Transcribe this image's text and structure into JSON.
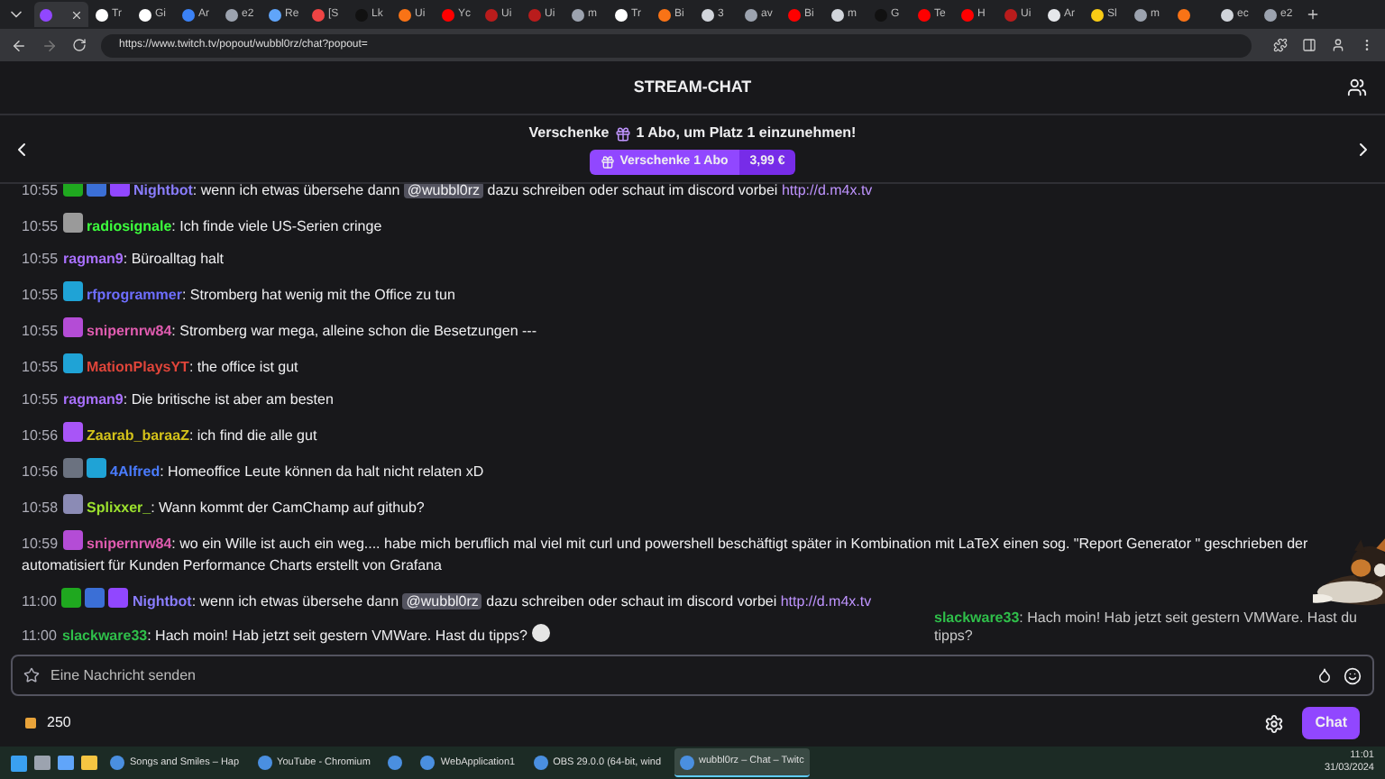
{
  "browser_tabs": [
    {
      "color": "#9147ff",
      "selected": true
    },
    {
      "label": "Tr",
      "color": "#ffffff",
      "selected": false
    },
    {
      "label": "Gi",
      "color": "#ffffff",
      "selected": false
    },
    {
      "label": "Ar",
      "color": "#3b82f6",
      "selected": false
    },
    {
      "label": "e2",
      "color": "#9ca3af",
      "selected": false
    },
    {
      "label": "Re",
      "color": "#60a5fa",
      "selected": false
    },
    {
      "label": "[S",
      "color": "#ef4444",
      "selected": false
    },
    {
      "label": "Lk",
      "color": "#111111",
      "selected": false
    },
    {
      "label": "Ui",
      "color": "#f97316",
      "selected": false
    },
    {
      "label": "Yc",
      "color": "#ff0000",
      "selected": false
    },
    {
      "label": "Ui",
      "color": "#b91c1c",
      "selected": false
    },
    {
      "label": "Ui",
      "color": "#b91c1c",
      "selected": false
    },
    {
      "label": "m",
      "color": "#9ca3af",
      "selected": false
    },
    {
      "label": "Tr",
      "color": "#ffffff",
      "selected": false
    },
    {
      "label": "Bi",
      "color": "#f97316",
      "selected": false
    },
    {
      "label": "3",
      "color": "#d1d5db",
      "selected": false
    },
    {
      "label": "av",
      "color": "#9ca3af",
      "selected": false
    },
    {
      "label": "Bi",
      "color": "#ff0000",
      "selected": false
    },
    {
      "label": "m",
      "color": "#d1d5db",
      "selected": false
    },
    {
      "label": "G",
      "color": "#111111",
      "selected": false
    },
    {
      "label": "Te",
      "color": "#ff0000",
      "selected": false
    },
    {
      "label": "H",
      "color": "#ff0000",
      "selected": false
    },
    {
      "label": "Ui",
      "color": "#b91c1c",
      "selected": false
    },
    {
      "label": "Ar",
      "color": "#e5e7eb",
      "selected": false
    },
    {
      "label": "Sl",
      "color": "#facc15",
      "selected": false
    },
    {
      "label": "m",
      "color": "#9ca3af",
      "selected": false
    },
    {
      "color": "#f97316",
      "selected": false
    },
    {
      "label": "ec",
      "color": "#d1d5db",
      "selected": false
    },
    {
      "label": "e2",
      "color": "#9ca3af",
      "selected": false
    }
  ],
  "address": "https://www.twitch.tv/popout/wubbl0rz/chat?popout=",
  "header": {
    "title": "STREAM-CHAT"
  },
  "banner": {
    "text": "Verschenke",
    "count": "1",
    "rest": "Abo, um Platz 1 einzunehmen!",
    "button": "Verschenke 1 Abo",
    "price": "3,99 €"
  },
  "messages": [
    {
      "time": "10:55",
      "badges": [
        {
          "color": "#1fa81f"
        },
        {
          "color": "#3b6fd6"
        },
        {
          "color": "#9147ff"
        }
      ],
      "user": "Nightbot",
      "color": "#8a7dff",
      "parts": [
        {
          "kind": "text",
          "text": ": wenn ich etwas übersehe dann "
        },
        {
          "kind": "mention",
          "text": "@wubbl0rz"
        },
        {
          "kind": "text",
          "text": " dazu schreiben oder schaut im discord vorbei "
        },
        {
          "kind": "link",
          "text": "http://d.m4x.tv"
        }
      ]
    },
    {
      "time": "10:55",
      "badges": [
        {
          "color": "#9a9a9a"
        }
      ],
      "user": "radiosignale",
      "color": "#3dff3d",
      "parts": [
        {
          "kind": "text",
          "text": ": Ich finde viele US-Serien cringe"
        }
      ]
    },
    {
      "time": "10:55",
      "user": "ragman9",
      "color": "#a970ff",
      "parts": [
        {
          "kind": "text",
          "text": ": Büroalltag halt"
        }
      ]
    },
    {
      "time": "10:55",
      "badges": [
        {
          "color": "#1fa3d6"
        }
      ],
      "user": "rfprogrammer",
      "color": "#6e6eff",
      "parts": [
        {
          "kind": "text",
          "text": ": Stromberg hat wenig mit the Office zu tun"
        }
      ]
    },
    {
      "time": "10:55",
      "badges": [
        {
          "color": "#b44cd6"
        }
      ],
      "user": "snipernrw84",
      "color": "#e05cb0",
      "parts": [
        {
          "kind": "text",
          "text": ": Stromberg war mega, alleine schon die Besetzungen ---"
        }
      ]
    },
    {
      "time": "10:55",
      "badges": [
        {
          "color": "#1fa3d6"
        }
      ],
      "user": "MationPlaysYT",
      "color": "#e0453a",
      "parts": [
        {
          "kind": "text",
          "text": ": the office ist gut"
        }
      ]
    },
    {
      "time": "10:55",
      "user": "ragman9",
      "color": "#a970ff",
      "parts": [
        {
          "kind": "text",
          "text": ": Die britische ist aber am besten"
        }
      ]
    },
    {
      "time": "10:56",
      "badges": [
        {
          "color": "#a855f7"
        }
      ],
      "user": "Zaarab_baraaZ",
      "color": "#d4c21a",
      "parts": [
        {
          "kind": "text",
          "text": ": ich find die alle gut"
        }
      ]
    },
    {
      "time": "10:56",
      "badges": [
        {
          "color": "#6b7280"
        },
        {
          "color": "#1fa3d6"
        }
      ],
      "user": "4Alfred",
      "color": "#4a7cff",
      "parts": [
        {
          "kind": "text",
          "text": ": Homeoffice Leute können da halt nicht relaten xD"
        }
      ]
    },
    {
      "time": "10:58",
      "badges": [
        {
          "color": "#8b8bb5"
        }
      ],
      "user": "Splixxer_",
      "color": "#9be02e",
      "parts": [
        {
          "kind": "text",
          "text": ": Wann kommt der CamChamp auf github?"
        }
      ]
    },
    {
      "time": "10:59",
      "badges": [
        {
          "color": "#b44cd6"
        }
      ],
      "user": "snipernrw84",
      "color": "#e05cb0",
      "parts": [
        {
          "kind": "text",
          "text": ": wo ein Wille ist auch ein weg.... habe mich beruflich mal viel mit curl und powershell beschäftigt später in Kombination mit LaTeX einen sog. \"Report Generator \" geschrieben der"
        },
        {
          "kind": "wrap",
          "text": "automatisiert für Kunden Performance Charts erstellt von Grafana"
        }
      ]
    },
    {
      "time": "11:00",
      "badges": [
        {
          "color": "#1fa81f"
        },
        {
          "color": "#3b6fd6"
        },
        {
          "color": "#9147ff"
        }
      ],
      "user": "Nightbot",
      "color": "#8a7dff",
      "parts": [
        {
          "kind": "text",
          "text": ": wenn ich etwas übersehe dann "
        },
        {
          "kind": "mention",
          "text": "@wubbl0rz"
        },
        {
          "kind": "text",
          "text": " dazu schreiben oder schaut im discord vorbei "
        },
        {
          "kind": "link",
          "text": "http://d.m4x.tv"
        }
      ]
    },
    {
      "time": "11:00",
      "user": "slackware33",
      "color": "#2fbf4a",
      "parts": [
        {
          "kind": "text",
          "text": ": Hach moin! Hab jetzt seit gestern VMWare. Hast du tipps? "
        },
        {
          "kind": "emote"
        }
      ]
    }
  ],
  "overlay": {
    "user": "slackware33",
    "text": ": Hach moin! Hab jetzt seit gestern VMWare. Hast du tipps?"
  },
  "input": {
    "placeholder": "Eine Nachricht senden"
  },
  "points": "250",
  "chat_button": "Chat",
  "taskbar": [
    {
      "label": "Songs and Smiles – Hap",
      "selected": false
    },
    {
      "label": "YouTube - Chromium",
      "selected": false
    },
    {
      "selected": false
    },
    {
      "label": "WebApplication1",
      "selected": false
    },
    {
      "label": "OBS 29.0.0 (64-bit, wind",
      "selected": false
    },
    {
      "label": "wubbl0rz – Chat – Twitc",
      "selected": true
    }
  ],
  "clock": {
    "time": "11:01",
    "date": "31/03/2024"
  }
}
